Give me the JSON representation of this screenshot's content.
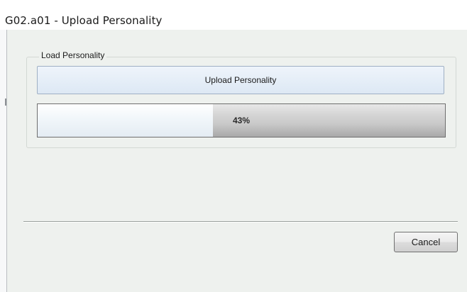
{
  "window": {
    "title": "G02.a01 - Upload Personality"
  },
  "group": {
    "label": "Load Personality"
  },
  "upload_button": {
    "label": "Upload Personality"
  },
  "progress": {
    "percent": 43,
    "text": "43%"
  },
  "footer": {
    "cancel_label": "Cancel"
  },
  "colors": {
    "client_background": "#eef1ee",
    "button_accent": "#dde8f4"
  }
}
